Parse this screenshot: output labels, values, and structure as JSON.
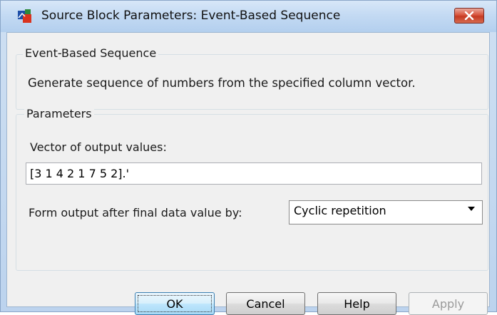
{
  "window": {
    "title": "Source Block Parameters: Event-Based Sequence",
    "icons": {
      "app": "simulink-block-icon",
      "close": "close-icon"
    }
  },
  "block_group": {
    "legend": "Event-Based Sequence",
    "description": "Generate sequence of numbers from the specified column vector."
  },
  "parameters": {
    "legend": "Parameters",
    "vector_label": "Vector of output values:",
    "vector_value": "[3 1 4 2 1 7 5 2].'",
    "form_output_label": "Form output after final data value by:",
    "form_output_value": "Cyclic repetition"
  },
  "buttons": {
    "ok": "OK",
    "cancel": "Cancel",
    "help": "Help",
    "apply": "Apply"
  },
  "colors": {
    "title_bar": "#c4daf3",
    "close_button": "#c53a22",
    "default_button": "#bee6fd"
  }
}
